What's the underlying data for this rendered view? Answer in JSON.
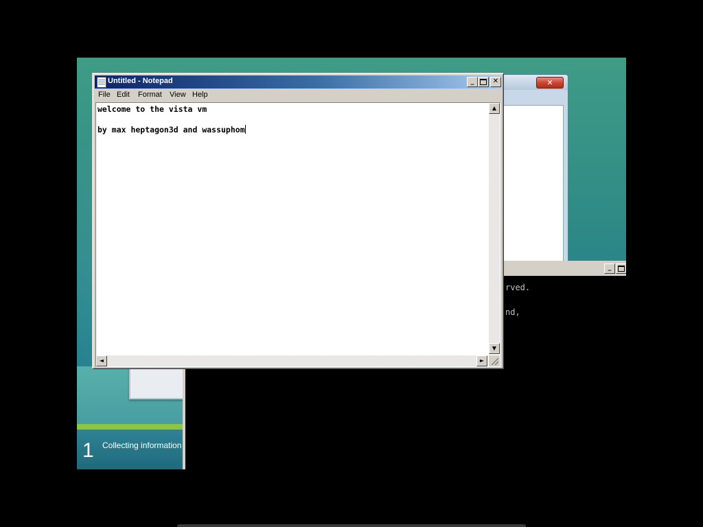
{
  "notepad": {
    "title": "Untitled - Notepad",
    "buttons": {
      "minimize": "_",
      "maximize": "",
      "close": "✕"
    },
    "menu": [
      "File",
      "Edit",
      "Format",
      "View",
      "Help"
    ],
    "text_lines": [
      "welcome to the vista vm",
      "",
      "by max heptagon3d and wassuphom"
    ]
  },
  "background_window": {
    "close_label": "✕"
  },
  "cmd": {
    "minimize": "_",
    "lines": [
      "rved.",
      "nd,"
    ]
  },
  "setup": {
    "step_number": "1",
    "step_label": "Collecting information"
  },
  "scroll": {
    "up": "▲",
    "down": "▼",
    "left": "◄",
    "right": "►"
  }
}
